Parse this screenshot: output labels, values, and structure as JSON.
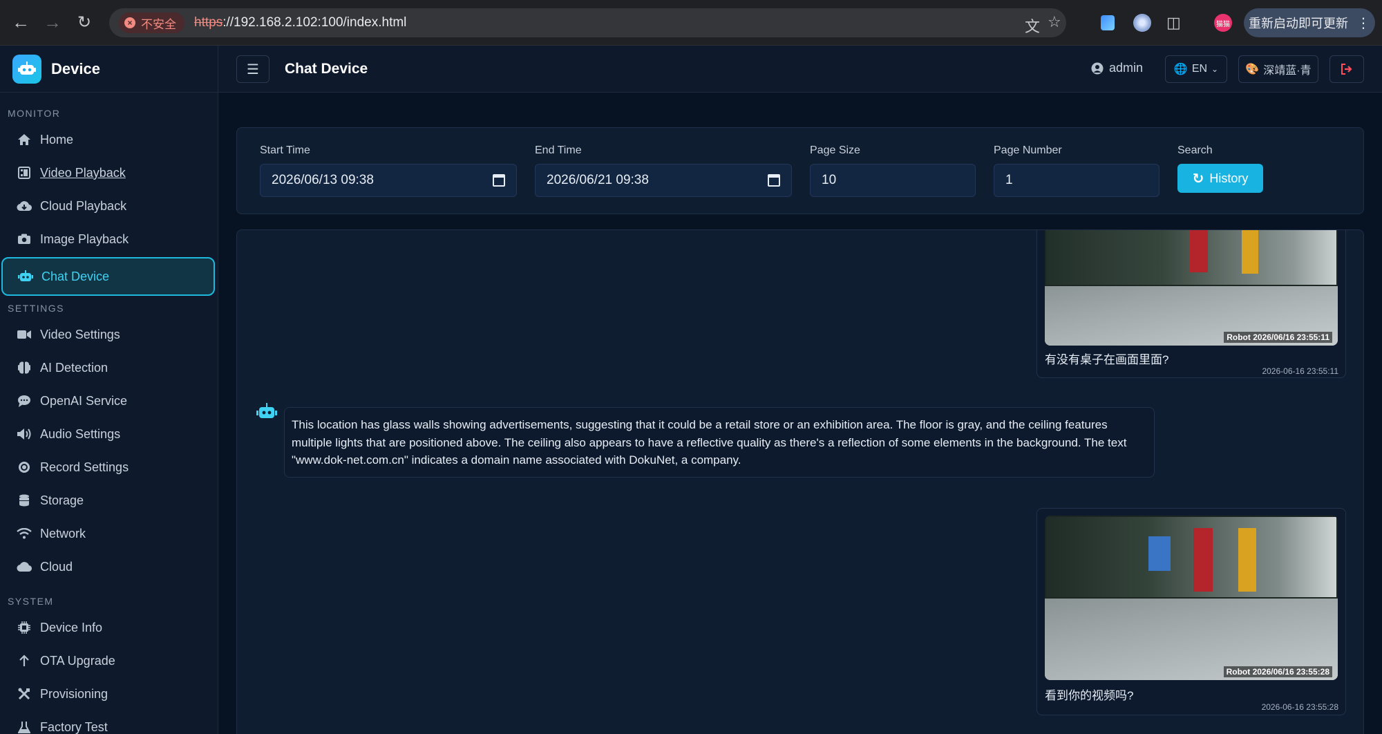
{
  "browser": {
    "insecure_label": "不安全",
    "url_scheme": "https",
    "url_rest": "://192.168.2.102:100/index.html",
    "profile_initials": "猫猫",
    "update_label": "重新启动即可更新"
  },
  "sidebar": {
    "brand": "Device",
    "sections": [
      {
        "title": "MONITOR",
        "items": [
          {
            "label": "Home",
            "icon": "home-icon"
          },
          {
            "label": "Video Playback",
            "icon": "film-icon"
          },
          {
            "label": "Cloud Playback",
            "icon": "cloud-download-icon"
          },
          {
            "label": "Image Playback",
            "icon": "camera-icon"
          },
          {
            "label": "Chat Device",
            "icon": "robot-icon",
            "active": true
          }
        ]
      },
      {
        "title": "SETTINGS",
        "items": [
          {
            "label": "Video Settings",
            "icon": "video-camera-icon"
          },
          {
            "label": "AI Detection",
            "icon": "brain-icon"
          },
          {
            "label": "OpenAI Service",
            "icon": "chat-bubble-icon"
          },
          {
            "label": "Audio Settings",
            "icon": "speaker-icon"
          },
          {
            "label": "Record Settings",
            "icon": "record-icon"
          },
          {
            "label": "Storage",
            "icon": "database-icon"
          },
          {
            "label": "Network",
            "icon": "wifi-icon"
          },
          {
            "label": "Cloud",
            "icon": "cloud-icon"
          }
        ]
      },
      {
        "title": "SYSTEM",
        "items": [
          {
            "label": "Device Info",
            "icon": "chip-icon"
          },
          {
            "label": "OTA Upgrade",
            "icon": "arrow-up-icon"
          },
          {
            "label": "Provisioning",
            "icon": "tools-icon"
          },
          {
            "label": "Factory Test",
            "icon": "flask-icon"
          }
        ]
      }
    ]
  },
  "header": {
    "title": "Chat Device",
    "user": "admin",
    "language": "EN",
    "theme": "深靖蓝·青"
  },
  "filters": {
    "start_label": "Start Time",
    "start_value": "2026/06/13 09:38",
    "end_label": "End Time",
    "end_value": "2026/06/21 09:38",
    "page_size_label": "Page Size",
    "page_size_value": "10",
    "page_number_label": "Page Number",
    "page_number_value": "1",
    "search_label": "Search",
    "history_button": "History"
  },
  "chat": {
    "messages": [
      {
        "role": "user",
        "stamp": "Robot  2026/06/16 23:55:11",
        "text": "有没有桌子在画面里面?",
        "time": "2026-06-16 23:55:11"
      },
      {
        "role": "bot",
        "text": "This location has glass walls showing advertisements, suggesting that it could be a retail store or an exhibition area. The floor is gray, and the ceiling features multiple lights that are positioned above. The ceiling also appears to have a reflective quality as there's a reflection of some elements in the background. The text \"www.dok-net.com.cn\" indicates a domain name associated with DokuNet, a company."
      },
      {
        "role": "user",
        "stamp": "Robot  2026/06/16 23:55:28",
        "text": "看到你的视频吗?",
        "time": "2026-06-16 23:55:28"
      }
    ]
  },
  "colors": {
    "accent": "#1fb8df",
    "background": "#071222",
    "panel": "#0f1d31",
    "danger": "#ff4d5e"
  }
}
